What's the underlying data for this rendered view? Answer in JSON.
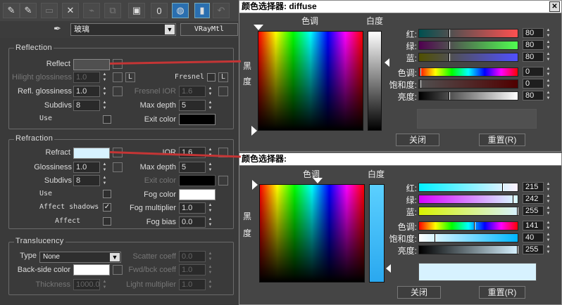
{
  "left_panel": {
    "material_name": "玻璃",
    "material_type": "VRayMtl",
    "reflection": {
      "title": "Reflection",
      "reflect_label": "Reflect",
      "hilight_label": "Hilight glossiness",
      "hilight_value": "1.0",
      "l_label": "L",
      "fresnel_label": "Fresnel",
      "refl_gloss_label": "Refl. glossiness",
      "refl_gloss_value": "1.0",
      "fresnel_ior_label": "Fresnel IOR",
      "fresnel_ior_value": "1.6",
      "subdivs_label": "Subdivs",
      "subdivs_value": "8",
      "maxdepth_label": "Max depth",
      "maxdepth_value": "5",
      "use_label": "Use",
      "exit_label": "Exit color"
    },
    "refraction": {
      "title": "Refraction",
      "refract_label": "Refract",
      "ior_label": "IOR",
      "ior_value": "1.6",
      "gloss_label": "Glossiness",
      "gloss_value": "1.0",
      "maxdepth_label": "Max depth",
      "maxdepth_value": "5",
      "subdivs_label": "Subdivs",
      "subdivs_value": "8",
      "exit_label": "Exit color",
      "use_label": "Use",
      "fog_color_label": "Fog color",
      "affect_shadows_label": "Affect shadows",
      "fog_mult_label": "Fog multiplier",
      "fog_mult_value": "1.0",
      "affect_label": "Affect",
      "fog_bias_label": "Fog bias",
      "fog_bias_value": "0.0"
    },
    "translucency": {
      "title": "Translucency",
      "type_label": "Type",
      "type_value": "None",
      "scatter_label": "Scatter coeff",
      "scatter_value": "0.0",
      "backside_label": "Back-side color",
      "fwd_label": "Fwd/bck coeff",
      "fwd_value": "1.0",
      "thickness_label": "Thickness",
      "thickness_value": "1000.0",
      "light_label": "Light multiplier",
      "light_value": "1.0"
    }
  },
  "dialog1": {
    "title": "颜色选择器: diffuse",
    "hue_label": "色调",
    "white_label": "白度",
    "black_label": "黑度",
    "red_label": "红:",
    "green_label": "绿:",
    "blue_label": "蓝:",
    "hue2_label": "色调:",
    "sat_label": "饱和度:",
    "val_label": "亮度:",
    "red": "80",
    "green": "80",
    "blue": "80",
    "hue": "0",
    "sat": "0",
    "value": "80",
    "close_label": "关闭",
    "reset_label": "重置(R)"
  },
  "dialog2": {
    "title": "颜色选择器:",
    "hue_label": "色调",
    "white_label": "白度",
    "black_label": "黑度",
    "red_label": "红:",
    "green_label": "绿:",
    "blue_label": "蓝:",
    "hue2_label": "色调:",
    "sat_label": "饱和度:",
    "val_label": "亮度:",
    "red": "215",
    "green": "242",
    "blue": "255",
    "hue": "141",
    "sat": "40",
    "value": "255",
    "close_label": "关闭",
    "reset_label": "重置(R)"
  },
  "colors": {
    "reflect_swatch": "#505050",
    "refract_swatch": "#d7f2ff",
    "exit_color": "#000000",
    "fog_color": "#ffffff",
    "backside_color": "#ffffff",
    "annotation_line": "#c43535"
  }
}
